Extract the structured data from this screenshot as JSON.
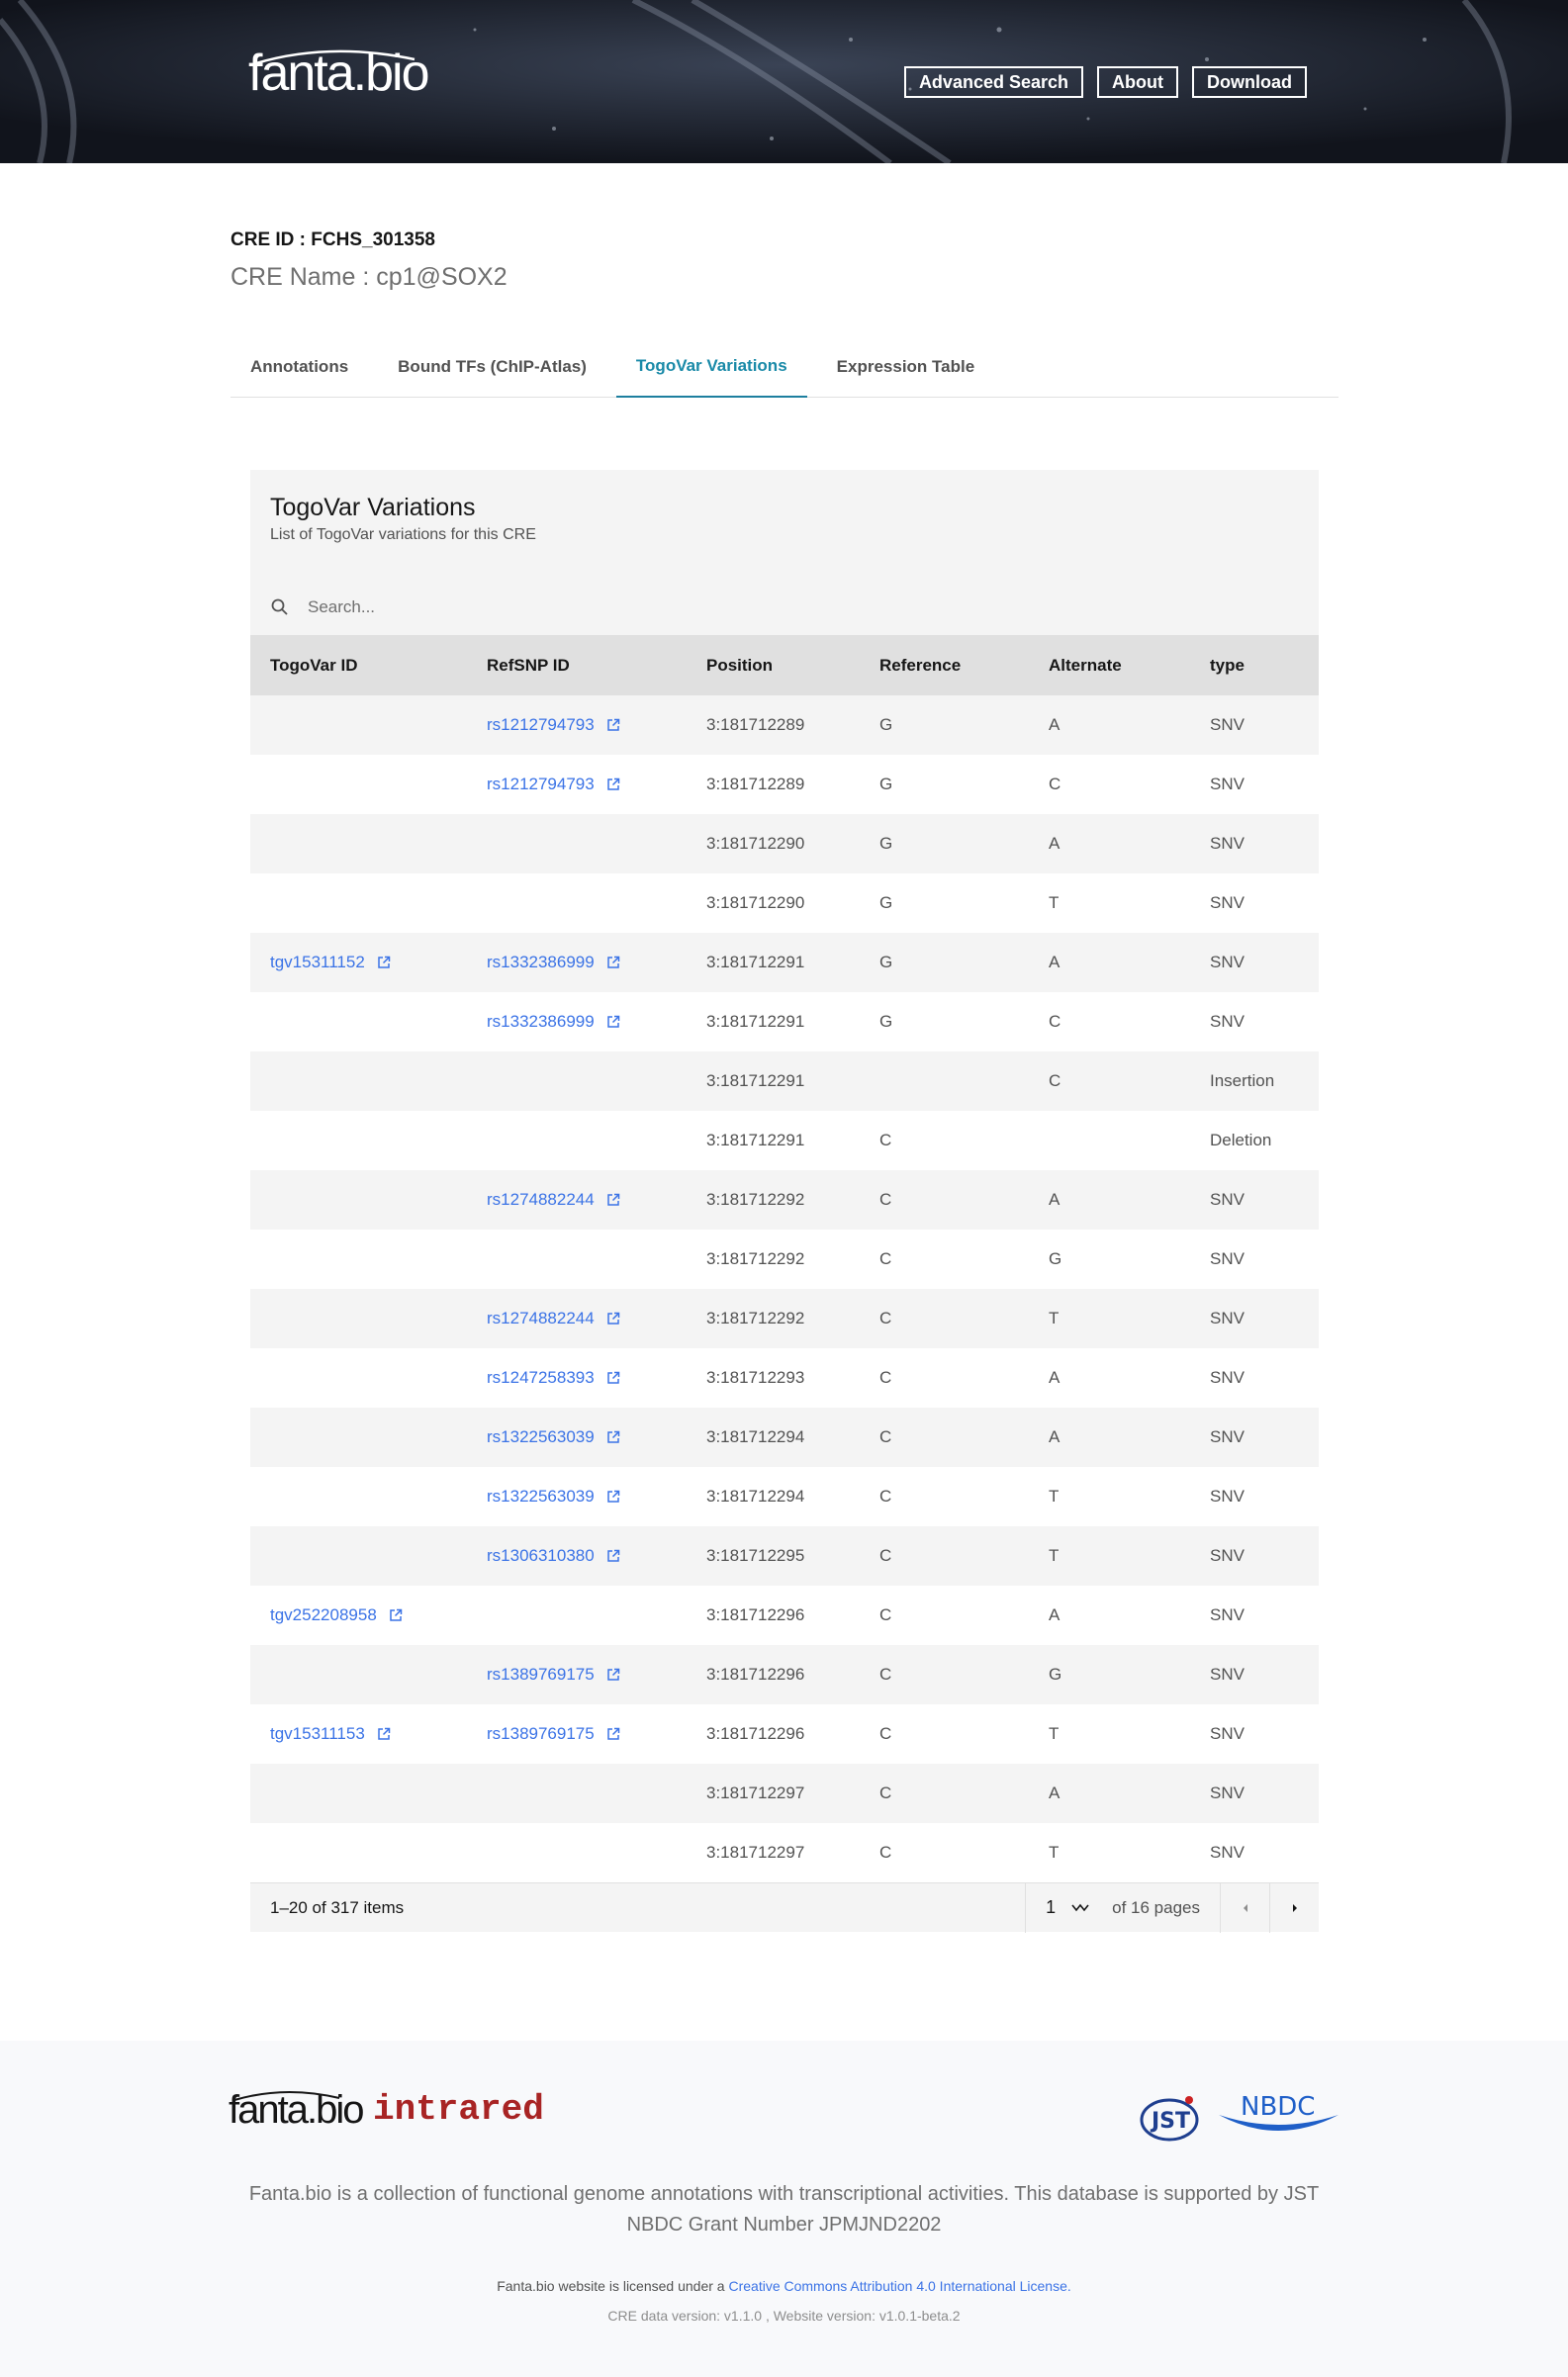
{
  "header": {
    "logo": "fanta.bio",
    "nav": [
      "Advanced Search",
      "About",
      "Download"
    ]
  },
  "cre": {
    "id_line": "CRE ID : FCHS_301358",
    "name_line": "CRE Name : cp1@SOX2"
  },
  "tabs": [
    {
      "label": "Annotations",
      "active": false
    },
    {
      "label": "Bound TFs (ChIP-Atlas)",
      "active": false
    },
    {
      "label": "TogoVar Variations",
      "active": true
    },
    {
      "label": "Expression Table",
      "active": false
    }
  ],
  "table": {
    "title": "TogoVar Variations",
    "description": "List of TogoVar variations for this CRE",
    "search_placeholder": "Search...",
    "columns": [
      "TogoVar ID",
      "RefSNP ID",
      "Position",
      "Reference",
      "Alternate",
      "type"
    ],
    "rows": [
      [
        "",
        "rs1212794793",
        "3:181712289",
        "G",
        "A",
        "SNV"
      ],
      [
        "",
        "rs1212794793",
        "3:181712289",
        "G",
        "C",
        "SNV"
      ],
      [
        "",
        "",
        "3:181712290",
        "G",
        "A",
        "SNV"
      ],
      [
        "",
        "",
        "3:181712290",
        "G",
        "T",
        "SNV"
      ],
      [
        "tgv15311152",
        "rs1332386999",
        "3:181712291",
        "G",
        "A",
        "SNV"
      ],
      [
        "",
        "rs1332386999",
        "3:181712291",
        "G",
        "C",
        "SNV"
      ],
      [
        "",
        "",
        "3:181712291",
        "",
        "C",
        "Insertion"
      ],
      [
        "",
        "",
        "3:181712291",
        "C",
        "",
        "Deletion"
      ],
      [
        "",
        "rs1274882244",
        "3:181712292",
        "C",
        "A",
        "SNV"
      ],
      [
        "",
        "",
        "3:181712292",
        "C",
        "G",
        "SNV"
      ],
      [
        "",
        "rs1274882244",
        "3:181712292",
        "C",
        "T",
        "SNV"
      ],
      [
        "",
        "rs1247258393",
        "3:181712293",
        "C",
        "A",
        "SNV"
      ],
      [
        "",
        "rs1322563039",
        "3:181712294",
        "C",
        "A",
        "SNV"
      ],
      [
        "",
        "rs1322563039",
        "3:181712294",
        "C",
        "T",
        "SNV"
      ],
      [
        "",
        "rs1306310380",
        "3:181712295",
        "C",
        "T",
        "SNV"
      ],
      [
        "tgv252208958",
        "",
        "3:181712296",
        "C",
        "A",
        "SNV"
      ],
      [
        "",
        "rs1389769175",
        "3:181712296",
        "C",
        "G",
        "SNV"
      ],
      [
        "tgv15311153",
        "rs1389769175",
        "3:181712296",
        "C",
        "T",
        "SNV"
      ],
      [
        "",
        "",
        "3:181712297",
        "C",
        "A",
        "SNV"
      ],
      [
        "",
        "",
        "3:181712297",
        "C",
        "T",
        "SNV"
      ]
    ],
    "pagination": {
      "items_text": "1–20 of 317 items",
      "page": "1",
      "of_pages": "of 16 pages"
    }
  },
  "footer": {
    "logo1": "fanta.bio",
    "logo2": "intrared",
    "jst": "JST",
    "nbdc": "NBDC",
    "description": "Fanta.bio is a collection of functional genome annotations with transcriptional activities. This database is supported by JST NBDC Grant Number JPMJND2202",
    "license_prefix": "Fanta.bio website is licensed under a",
    "license_link": "Creative Commons Attribution 4.0 International License.",
    "version": "CRE data version: v1.1.0 , Website version: v1.0.1-beta.2"
  }
}
